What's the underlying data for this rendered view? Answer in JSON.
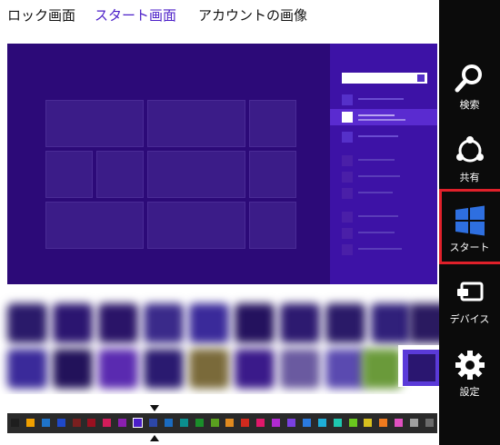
{
  "tabs": [
    {
      "label": "ロック画面"
    },
    {
      "label": "スタート画面",
      "selected": true
    },
    {
      "label": "アカウントの画像"
    }
  ],
  "charms": [
    {
      "label": "検索",
      "icon": "search-icon"
    },
    {
      "label": "共有",
      "icon": "share-icon"
    },
    {
      "label": "スタート",
      "icon": "windows-logo-icon",
      "highlighted": true
    },
    {
      "label": "デバイス",
      "icon": "devices-icon"
    },
    {
      "label": "設定",
      "icon": "gear-icon"
    }
  ],
  "colors": {
    "accent_tab": "#4b1ec8",
    "preview_background": "#2c0a78",
    "charm_bar": "#0b0b0b",
    "highlight_box": "#e0202a"
  },
  "background_colors": [
    "#1e1e1e",
    "#f0a000",
    "#1f74c9",
    "#1f49c9",
    "#7a1f1f",
    "#9a1020",
    "#d21c5a",
    "#8a1fb0",
    "#4b1ec8",
    "#2d47a8",
    "#1a6bc0",
    "#0b8e8e",
    "#1a8e2a",
    "#5aa01f",
    "#e08a1f",
    "#d22a1e",
    "#e0186a",
    "#b02ad0",
    "#7a40e0",
    "#2a7ae0",
    "#1eaed8",
    "#1ec8b0",
    "#6ac81e",
    "#d8c01e",
    "#f07a1e",
    "#e050c0",
    "#a0a0a0",
    "#6a6a6a"
  ],
  "selected_background_color": "#4b1ec8"
}
